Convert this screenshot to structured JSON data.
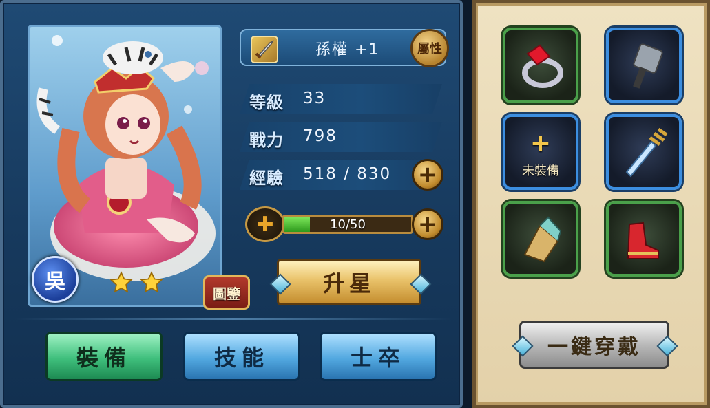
{
  "hero": {
    "name": "孫權 +1",
    "faction": "吳",
    "stars": 2,
    "attribute_button": "屬性",
    "codex_button": "圖鑒"
  },
  "stats": {
    "level_label": "等級",
    "level_value": "33",
    "power_label": "戰力",
    "power_value": "798",
    "exp_label": "經驗",
    "exp_value": "518 / 830"
  },
  "shards": {
    "text": "10/50",
    "progress": 0.2
  },
  "buttons": {
    "upgrade_star": "升星",
    "equip_all": "一鍵穿戴"
  },
  "tabs": [
    {
      "label": "裝備",
      "active": true
    },
    {
      "label": "技能",
      "active": false
    },
    {
      "label": "士卒",
      "active": false
    }
  ],
  "equipment": [
    {
      "name": "ring-icon",
      "rarity": "green"
    },
    {
      "name": "hammer-icon",
      "rarity": "blue"
    },
    {
      "name": "empty-slot",
      "rarity": "blue",
      "label": "未裝備"
    },
    {
      "name": "trident-dagger-icon",
      "rarity": "blue"
    },
    {
      "name": "gauntlet-icon",
      "rarity": "green"
    },
    {
      "name": "boots-icon",
      "rarity": "green"
    }
  ],
  "colors": {
    "green_rarity": "#4aa04a",
    "blue_rarity": "#3c8ee0",
    "gold": "#e9c26a"
  }
}
